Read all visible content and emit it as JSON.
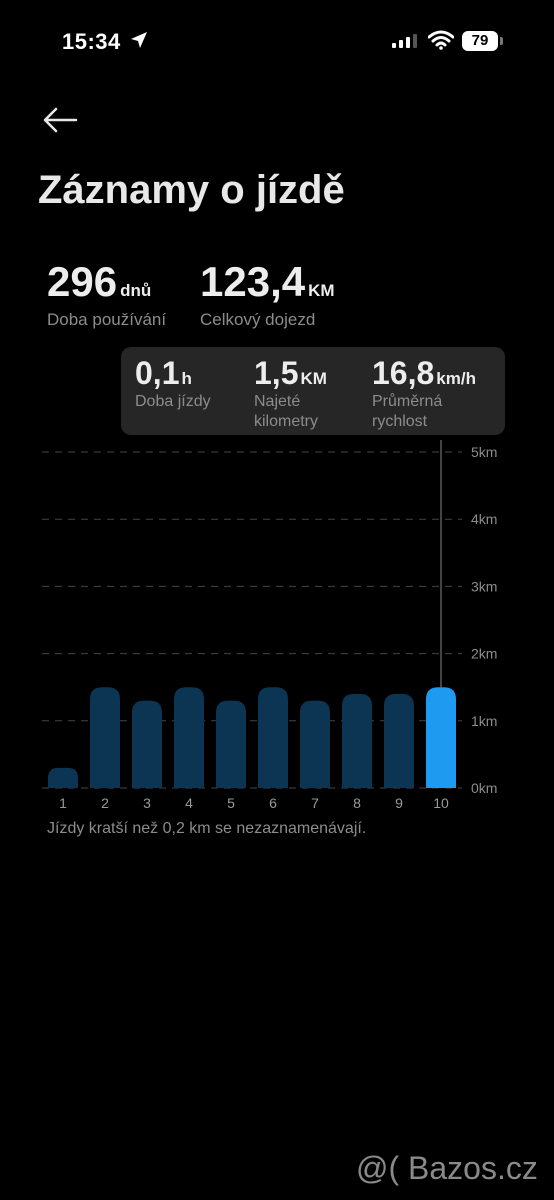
{
  "status": {
    "time": "15:34",
    "battery": "79"
  },
  "header": {
    "title": "Záznamy o jízdě"
  },
  "summary": {
    "days_value": "296",
    "days_unit": "dnů",
    "days_label": "Doba používání",
    "distance_value": "123,4",
    "distance_unit": "KM",
    "distance_label": "Celkový dojezd"
  },
  "tooltip": {
    "time_value": "0,1",
    "time_unit": "h",
    "time_label": "Doba jízdy",
    "km_value": "1,5",
    "km_unit": "KM",
    "km_label": "Najeté kilometry",
    "speed_value": "16,8",
    "speed_unit": "km/h",
    "speed_label": "Průměrná rychlost"
  },
  "chart_data": {
    "type": "bar",
    "categories": [
      "1",
      "2",
      "3",
      "4",
      "5",
      "6",
      "7",
      "8",
      "9",
      "10"
    ],
    "values": [
      0.3,
      1.5,
      1.3,
      1.5,
      1.3,
      1.5,
      1.3,
      1.4,
      1.4,
      1.5
    ],
    "y_ticks": [
      "0km",
      "1km",
      "2km",
      "3km",
      "4km",
      "5km"
    ],
    "ylim": [
      0,
      5
    ],
    "selected_index": 9,
    "grid": true,
    "colors": {
      "bar": "#0b3552",
      "selected": "#1e9bf0",
      "grid": "#444444"
    }
  },
  "footer": {
    "note": "Jízdy kratší než 0,2 km se nezaznamenávají."
  },
  "watermark": "@( Bazos.cz"
}
